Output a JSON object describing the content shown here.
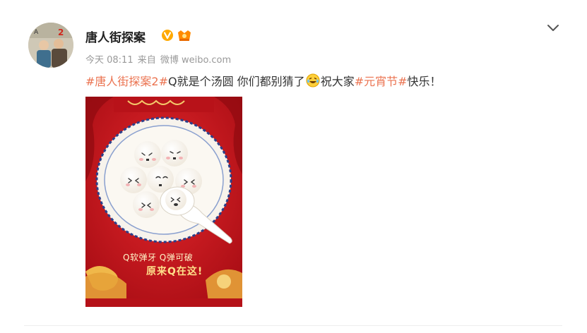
{
  "post": {
    "username": "唐人街探案",
    "time": "今天 08:11",
    "source_prefix": "来自",
    "source": "微博 weibo.com",
    "text": {
      "tag1": "#唐人街探案2#",
      "part1": "Q就是个汤圆 你们都别猜了",
      "emoji": "laughing-crying-emoji",
      "part2": "祝大家",
      "tag2": "#元宵节#",
      "part3": "快乐！"
    },
    "image": {
      "line1": "Q软弹牙  Q弹可破",
      "line2": "原来Q在这!"
    }
  },
  "colors": {
    "link": "#eb7350",
    "verified": "#ffa900",
    "meta": "#999999",
    "poster_red": "#c0141b"
  },
  "icons": [
    "avatar",
    "verified-icon",
    "vip-icon",
    "chevron-down-icon"
  ]
}
